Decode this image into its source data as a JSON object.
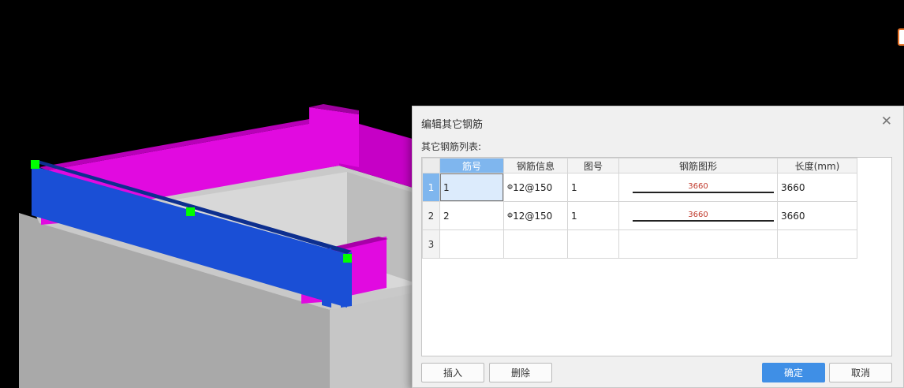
{
  "dialog": {
    "title": "编辑其它钢筋",
    "close_glyph": "✕",
    "list_label": "其它钢筋列表:"
  },
  "table": {
    "columns": [
      "筋号",
      "钢筋信息",
      "图号",
      "钢筋图形",
      "长度(mm)"
    ],
    "rows": [
      {
        "row_num": "1",
        "bar_no": "1",
        "steel_symbol": "Φ",
        "spec": "12@150",
        "figure_no": "1",
        "shape_dim": "3660",
        "length": "3660"
      },
      {
        "row_num": "2",
        "bar_no": "2",
        "steel_symbol": "Φ",
        "spec": "12@150",
        "figure_no": "1",
        "shape_dim": "3660",
        "length": "3660"
      },
      {
        "row_num": "3",
        "bar_no": "",
        "steel_symbol": "",
        "spec": "",
        "figure_no": "",
        "shape_dim": "",
        "length": ""
      }
    ]
  },
  "buttons": {
    "insert": "插入",
    "delete": "删除",
    "ok": "确定",
    "cancel": "取消"
  },
  "colors": {
    "beam_blue": "#1a4fd6",
    "wall_magenta": "#e10ae0",
    "slab_gray": "#c9c9c9",
    "grip_green": "#00ff00",
    "primary_button": "#3f8fe6",
    "header_highlight": "#7fb6ee"
  }
}
